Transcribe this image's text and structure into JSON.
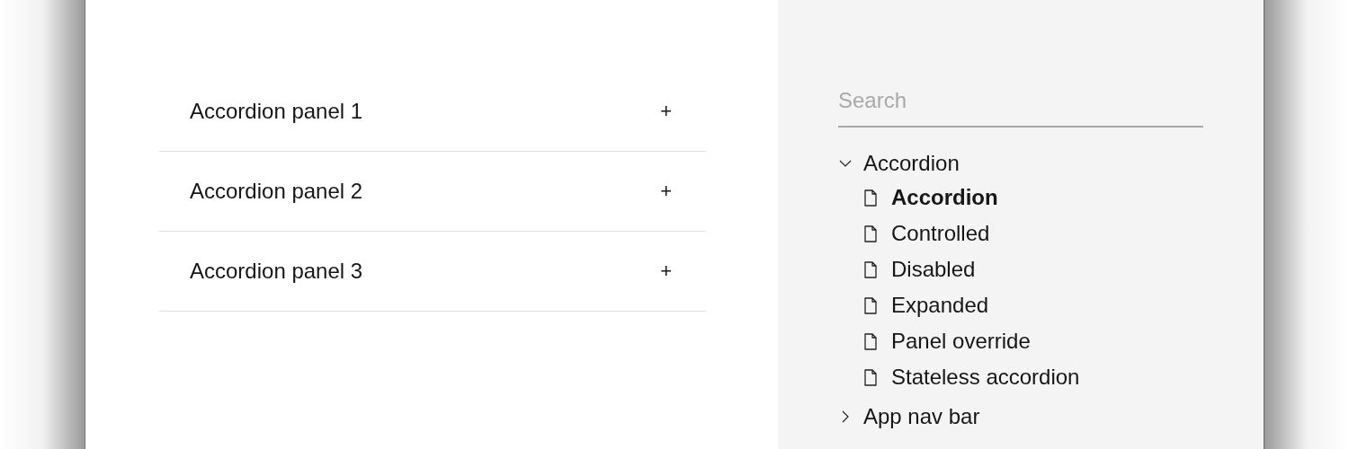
{
  "accordion": [
    {
      "title": "Accordion panel 1",
      "icon": "+"
    },
    {
      "title": "Accordion panel 2",
      "icon": "+"
    },
    {
      "title": "Accordion panel 3",
      "icon": "+"
    }
  ],
  "search": {
    "placeholder": "Search"
  },
  "tree": [
    {
      "label": "Accordion",
      "expanded": true,
      "children": [
        {
          "label": "Accordion",
          "selected": true
        },
        {
          "label": "Controlled",
          "selected": false
        },
        {
          "label": "Disabled",
          "selected": false
        },
        {
          "label": "Expanded",
          "selected": false
        },
        {
          "label": "Panel override",
          "selected": false
        },
        {
          "label": "Stateless accordion",
          "selected": false
        }
      ]
    },
    {
      "label": "App nav bar",
      "expanded": false
    }
  ]
}
